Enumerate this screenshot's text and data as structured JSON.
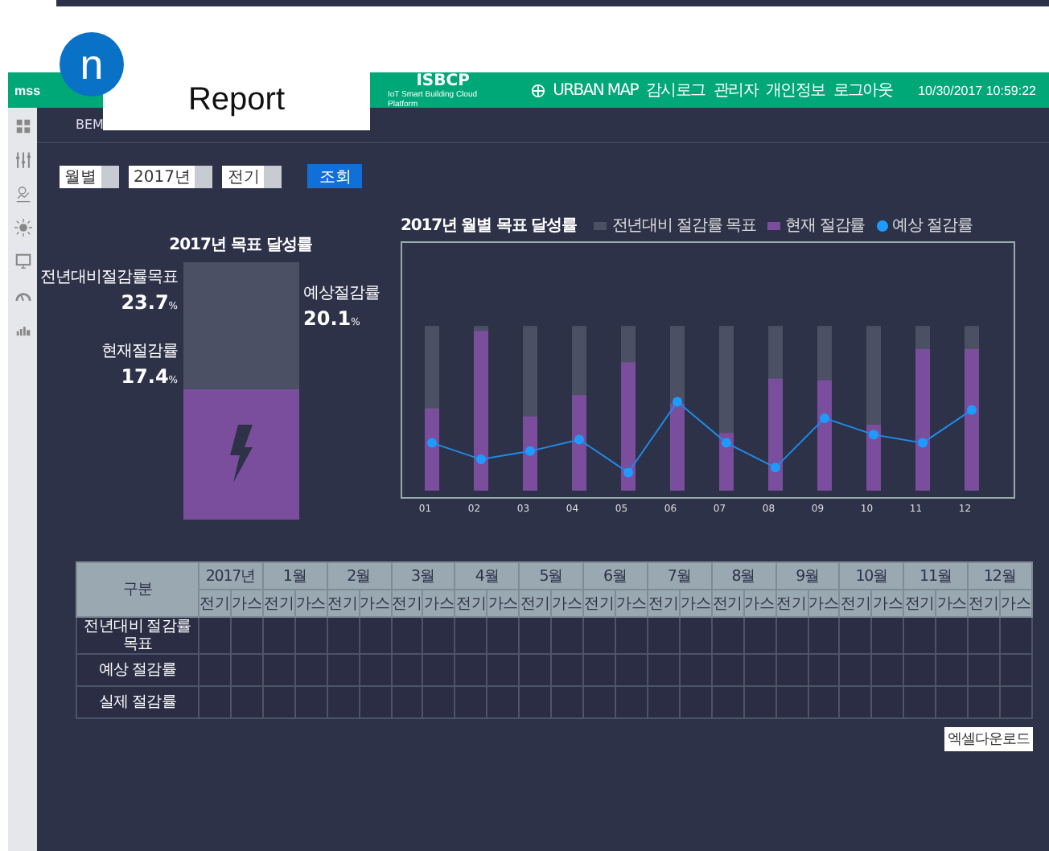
{
  "overlay": {
    "badge": "n",
    "title": "Report"
  },
  "header": {
    "logo": "mss",
    "title": "ISBCP",
    "subtitle": "IoT Smart Building Cloud Platform",
    "nav": [
      "URBAN MAP",
      "감시로그",
      "관리자",
      "개인정보",
      "로그아웃"
    ],
    "datetime": "10/30/2017 10:59:22"
  },
  "breadcrumb": [
    "BEM"
  ],
  "filters": {
    "selects": [
      "월별",
      "2017년",
      "전기"
    ],
    "button": "조회"
  },
  "goal": {
    "title": "2017년 목표 달성률",
    "stats": [
      {
        "label": "전년대비절감률목표",
        "value": "23.7",
        "unit": "%"
      },
      {
        "label": "현재절감률",
        "value": "17.4",
        "unit": "%"
      },
      {
        "label": "예상절감률",
        "value": "20.1",
        "unit": "%"
      }
    ]
  },
  "monthly": {
    "title": "2017년 월별 목표 달성률",
    "legend": [
      "전년대비 절감률 목표",
      "현재 절감률",
      "예상 절감률"
    ],
    "x_labels": [
      "01",
      "02",
      "03",
      "04",
      "05",
      "06",
      "07",
      "08",
      "09",
      "10",
      "11",
      "12"
    ]
  },
  "table": {
    "corner": "구분",
    "groups": [
      {
        "label": "2017년",
        "subcolumns": [
          "전기",
          "가스"
        ]
      },
      {
        "label": "1월",
        "subcolumns": [
          "전기",
          "가스"
        ]
      },
      {
        "label": "2월",
        "subcolumns": [
          "전기",
          "가스"
        ]
      },
      {
        "label": "3월",
        "subcolumns": [
          "전기",
          "가스"
        ]
      },
      {
        "label": "4월",
        "subcolumns": [
          "전기",
          "가스"
        ]
      },
      {
        "label": "5월",
        "subcolumns": [
          "전기",
          "가스"
        ]
      },
      {
        "label": "6월",
        "subcolumns": [
          "전기",
          "가스"
        ]
      },
      {
        "label": "7월",
        "subcolumns": [
          "전기",
          "가스"
        ]
      },
      {
        "label": "8월",
        "subcolumns": [
          "전기",
          "가스"
        ]
      },
      {
        "label": "9월",
        "subcolumns": [
          "전기",
          "가스"
        ]
      },
      {
        "label": "10월",
        "subcolumns": [
          "전기",
          "가스"
        ]
      },
      {
        "label": "11월",
        "subcolumns": [
          "전기",
          "가스"
        ]
      },
      {
        "label": "12월",
        "subcolumns": [
          "전기",
          "가스"
        ]
      }
    ],
    "rows": [
      "전년대비 절감률 목표",
      "예상 절감률",
      "실제 절감률"
    ]
  },
  "excel_button": "엑셀다운로드"
}
